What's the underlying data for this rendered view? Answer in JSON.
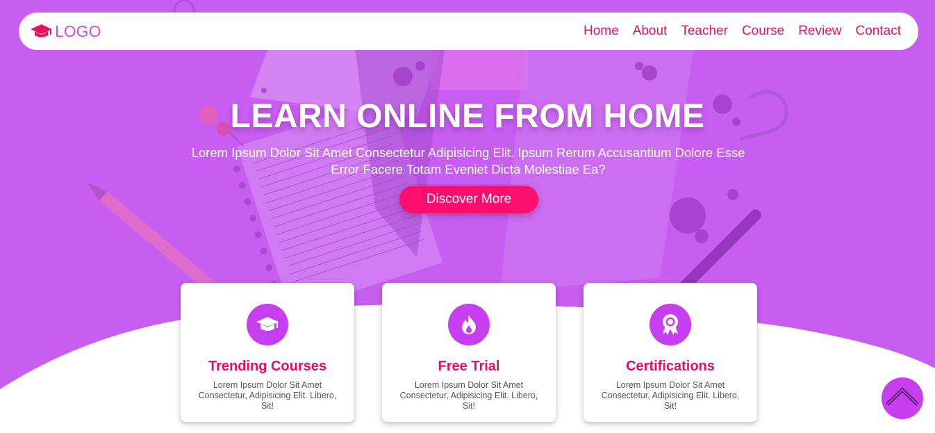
{
  "nav": {
    "logo_text": "LOGO",
    "logo_icon": "graduation-cap-icon",
    "links": [
      "Home",
      "About",
      "Teacher",
      "Course",
      "Review",
      "Contact"
    ]
  },
  "hero": {
    "title": "LEARN ONLINE FROM HOME",
    "subtitle": "Lorem Ipsum Dolor Sit Amet Consectetur Adipisicing Elit. Ipsum Rerum Accusantium Dolore Esse Error Facere Totam Eveniet Dicta Molestiae Ea?",
    "cta_label": "Discover More"
  },
  "cards": [
    {
      "icon": "graduation-cap-icon",
      "title": "Trending Courses",
      "text": "Lorem Ipsum Dolor Sit Amet Consectetur, Adipisicing Elit. Libero, Sit!"
    },
    {
      "icon": "fire-icon",
      "title": "Free Trial",
      "text": "Lorem Ipsum Dolor Sit Amet Consectetur, Adipisicing Elit. Libero, Sit!"
    },
    {
      "icon": "award-icon",
      "title": "Certifications",
      "text": "Lorem Ipsum Dolor Sit Amet Consectetur, Adipisicing Elit. Libero, Sit!"
    }
  ],
  "scroll_top_icon": "chevron-up-icon",
  "colors": {
    "hero_purple": "#c85ef1",
    "accent_pink": "#e5145e",
    "button_pink": "#fb0e6e",
    "icon_purple": "#c63ef0",
    "logo_purple": "#c94ee9"
  }
}
